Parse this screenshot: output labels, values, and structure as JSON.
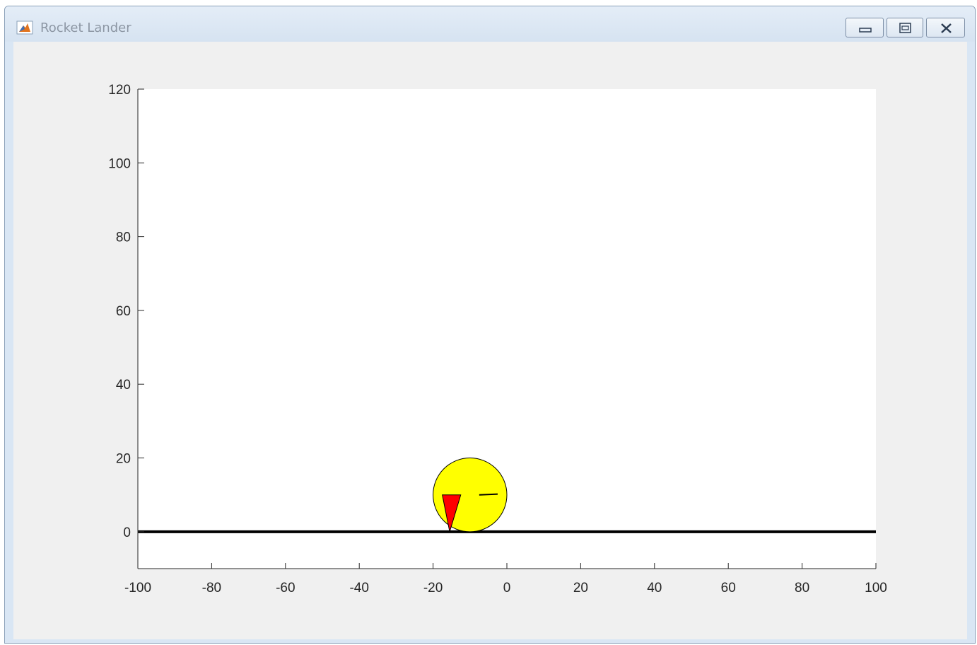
{
  "window": {
    "title": "Rocket Lander",
    "icons": {
      "app": "matlab-icon",
      "minimize": "minimize-icon",
      "maximize": "maximize-icon",
      "close": "close-icon"
    }
  },
  "chart_data": {
    "type": "scatter",
    "title": "",
    "xlabel": "",
    "ylabel": "",
    "xlim": [
      -100,
      100
    ],
    "ylim": [
      -10,
      120
    ],
    "x_ticks": [
      -100,
      -80,
      -60,
      -40,
      -20,
      0,
      20,
      40,
      60,
      80,
      100
    ],
    "y_ticks": [
      0,
      20,
      40,
      60,
      80,
      100,
      120
    ],
    "x_tick_labels": [
      "-100",
      "-80",
      "-60",
      "-40",
      "-20",
      "0",
      "20",
      "40",
      "60",
      "80",
      "100"
    ],
    "y_tick_labels": [
      "0",
      "20",
      "40",
      "60",
      "80",
      "100",
      "120"
    ],
    "grid": false,
    "ground": {
      "y": 0,
      "x_from": -100,
      "x_to": 100,
      "color": "#000000"
    },
    "rocket_body": {
      "center_x": -10,
      "center_y": 10,
      "radius": 10,
      "color": "#ffff00"
    },
    "left_thruster": {
      "points": [
        [
          -17.5,
          10
        ],
        [
          -12.5,
          10
        ],
        [
          -15.5,
          0
        ]
      ],
      "color": "#ff0000"
    },
    "right_thrust_line": {
      "from": [
        -7.5,
        10
      ],
      "to": [
        -2.5,
        10.2
      ]
    }
  }
}
